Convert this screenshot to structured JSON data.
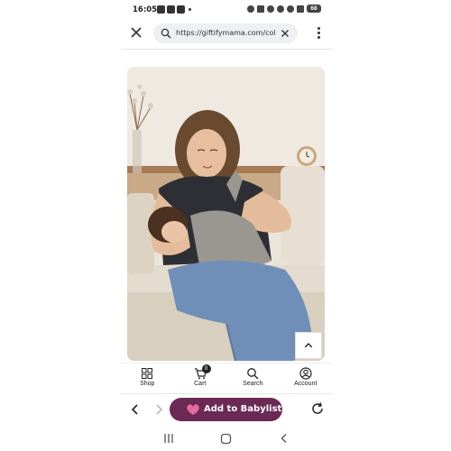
{
  "status_bar": {
    "time": "16:05",
    "battery": "68"
  },
  "browser": {
    "url": "https://giftifymama.com/col",
    "icons": {
      "close": "close-icon",
      "search": "search-icon",
      "clear": "clear-icon",
      "menu": "more-vert-icon"
    }
  },
  "product": {
    "image_description_icon": "product-photo",
    "scroll_top_icon": "chevron-up-icon"
  },
  "bottom_nav": {
    "items": [
      {
        "label": "Shop",
        "icon": "grid-icon"
      },
      {
        "label": "Cart",
        "icon": "cart-icon",
        "badge": "0"
      },
      {
        "label": "Search",
        "icon": "search-icon"
      },
      {
        "label": "Account",
        "icon": "account-icon"
      }
    ]
  },
  "toolbar": {
    "babylist_label": "Add to Babylist",
    "accent_color": "#6a2a54",
    "heart_color": "#e56aa0"
  }
}
